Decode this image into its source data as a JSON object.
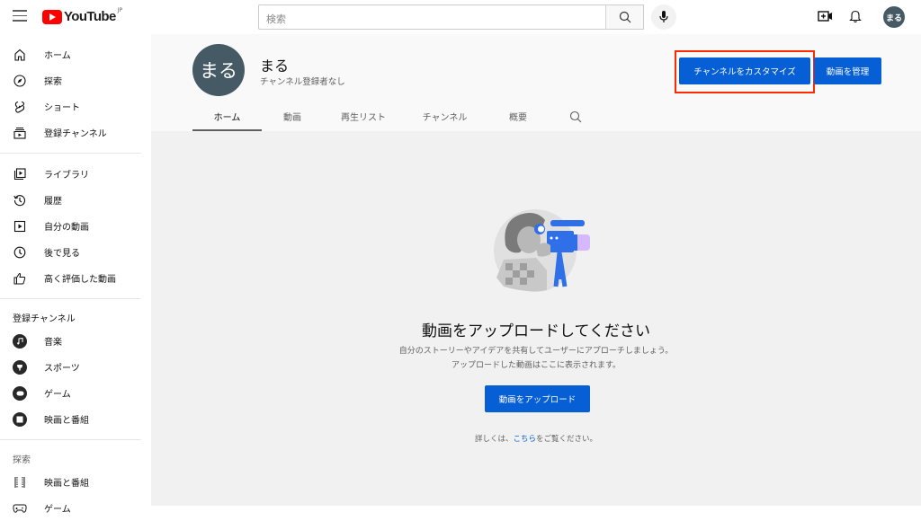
{
  "header": {
    "logo_text": "YouTube",
    "logo_region": "JP",
    "search_placeholder": "検索",
    "avatar_text": "まる"
  },
  "sidebar": {
    "main_items": [
      {
        "label": "ホーム",
        "icon": "home-icon"
      },
      {
        "label": "探索",
        "icon": "compass-icon"
      },
      {
        "label": "ショート",
        "icon": "shorts-icon"
      },
      {
        "label": "登録チャンネル",
        "icon": "subscriptions-icon"
      }
    ],
    "library_items": [
      {
        "label": "ライブラリ",
        "icon": "library-icon"
      },
      {
        "label": "履歴",
        "icon": "history-icon"
      },
      {
        "label": "自分の動画",
        "icon": "your-videos-icon"
      },
      {
        "label": "後で見る",
        "icon": "watch-later-icon"
      },
      {
        "label": "高く評価した動画",
        "icon": "thumbs-up-icon"
      }
    ],
    "subscriptions_heading": "登録チャンネル",
    "subscriptions": [
      {
        "label": "音楽",
        "icon": "music-icon"
      },
      {
        "label": "スポーツ",
        "icon": "trophy-icon"
      },
      {
        "label": "ゲーム",
        "icon": "gaming-icon"
      },
      {
        "label": "映画と番組",
        "icon": "movies-icon"
      }
    ],
    "explore_heading": "探索",
    "explore_items": [
      {
        "label": "映画と番組",
        "icon": "film-strip-icon"
      },
      {
        "label": "ゲーム",
        "icon": "gamepad-icon"
      }
    ]
  },
  "channel": {
    "avatar_text": "まる",
    "name": "まる",
    "subscribers": "チャンネル登録者なし",
    "customize_button": "チャンネルをカスタマイズ",
    "manage_button": "動画を管理",
    "highlight_color": "#ff2a00",
    "tabs": [
      {
        "label": "ホーム",
        "active": true
      },
      {
        "label": "動画",
        "active": false
      },
      {
        "label": "再生リスト",
        "active": false
      },
      {
        "label": "チャンネル",
        "active": false
      },
      {
        "label": "概要",
        "active": false
      }
    ]
  },
  "empty_state": {
    "title": "動画をアップロードしてください",
    "description_line1": "自分のストーリーやアイデアを共有してユーザーにアプローチしましょう。",
    "description_line2": "アップロードした動画はここに表示されます。",
    "upload_button": "動画をアップロード",
    "more_info_prefix": "詳しくは、",
    "more_info_link": "こちら",
    "more_info_suffix": "をご覧ください。"
  },
  "colors": {
    "accent": "#065fd4",
    "brand": "#ff0000",
    "avatar_bg": "#455a64"
  }
}
